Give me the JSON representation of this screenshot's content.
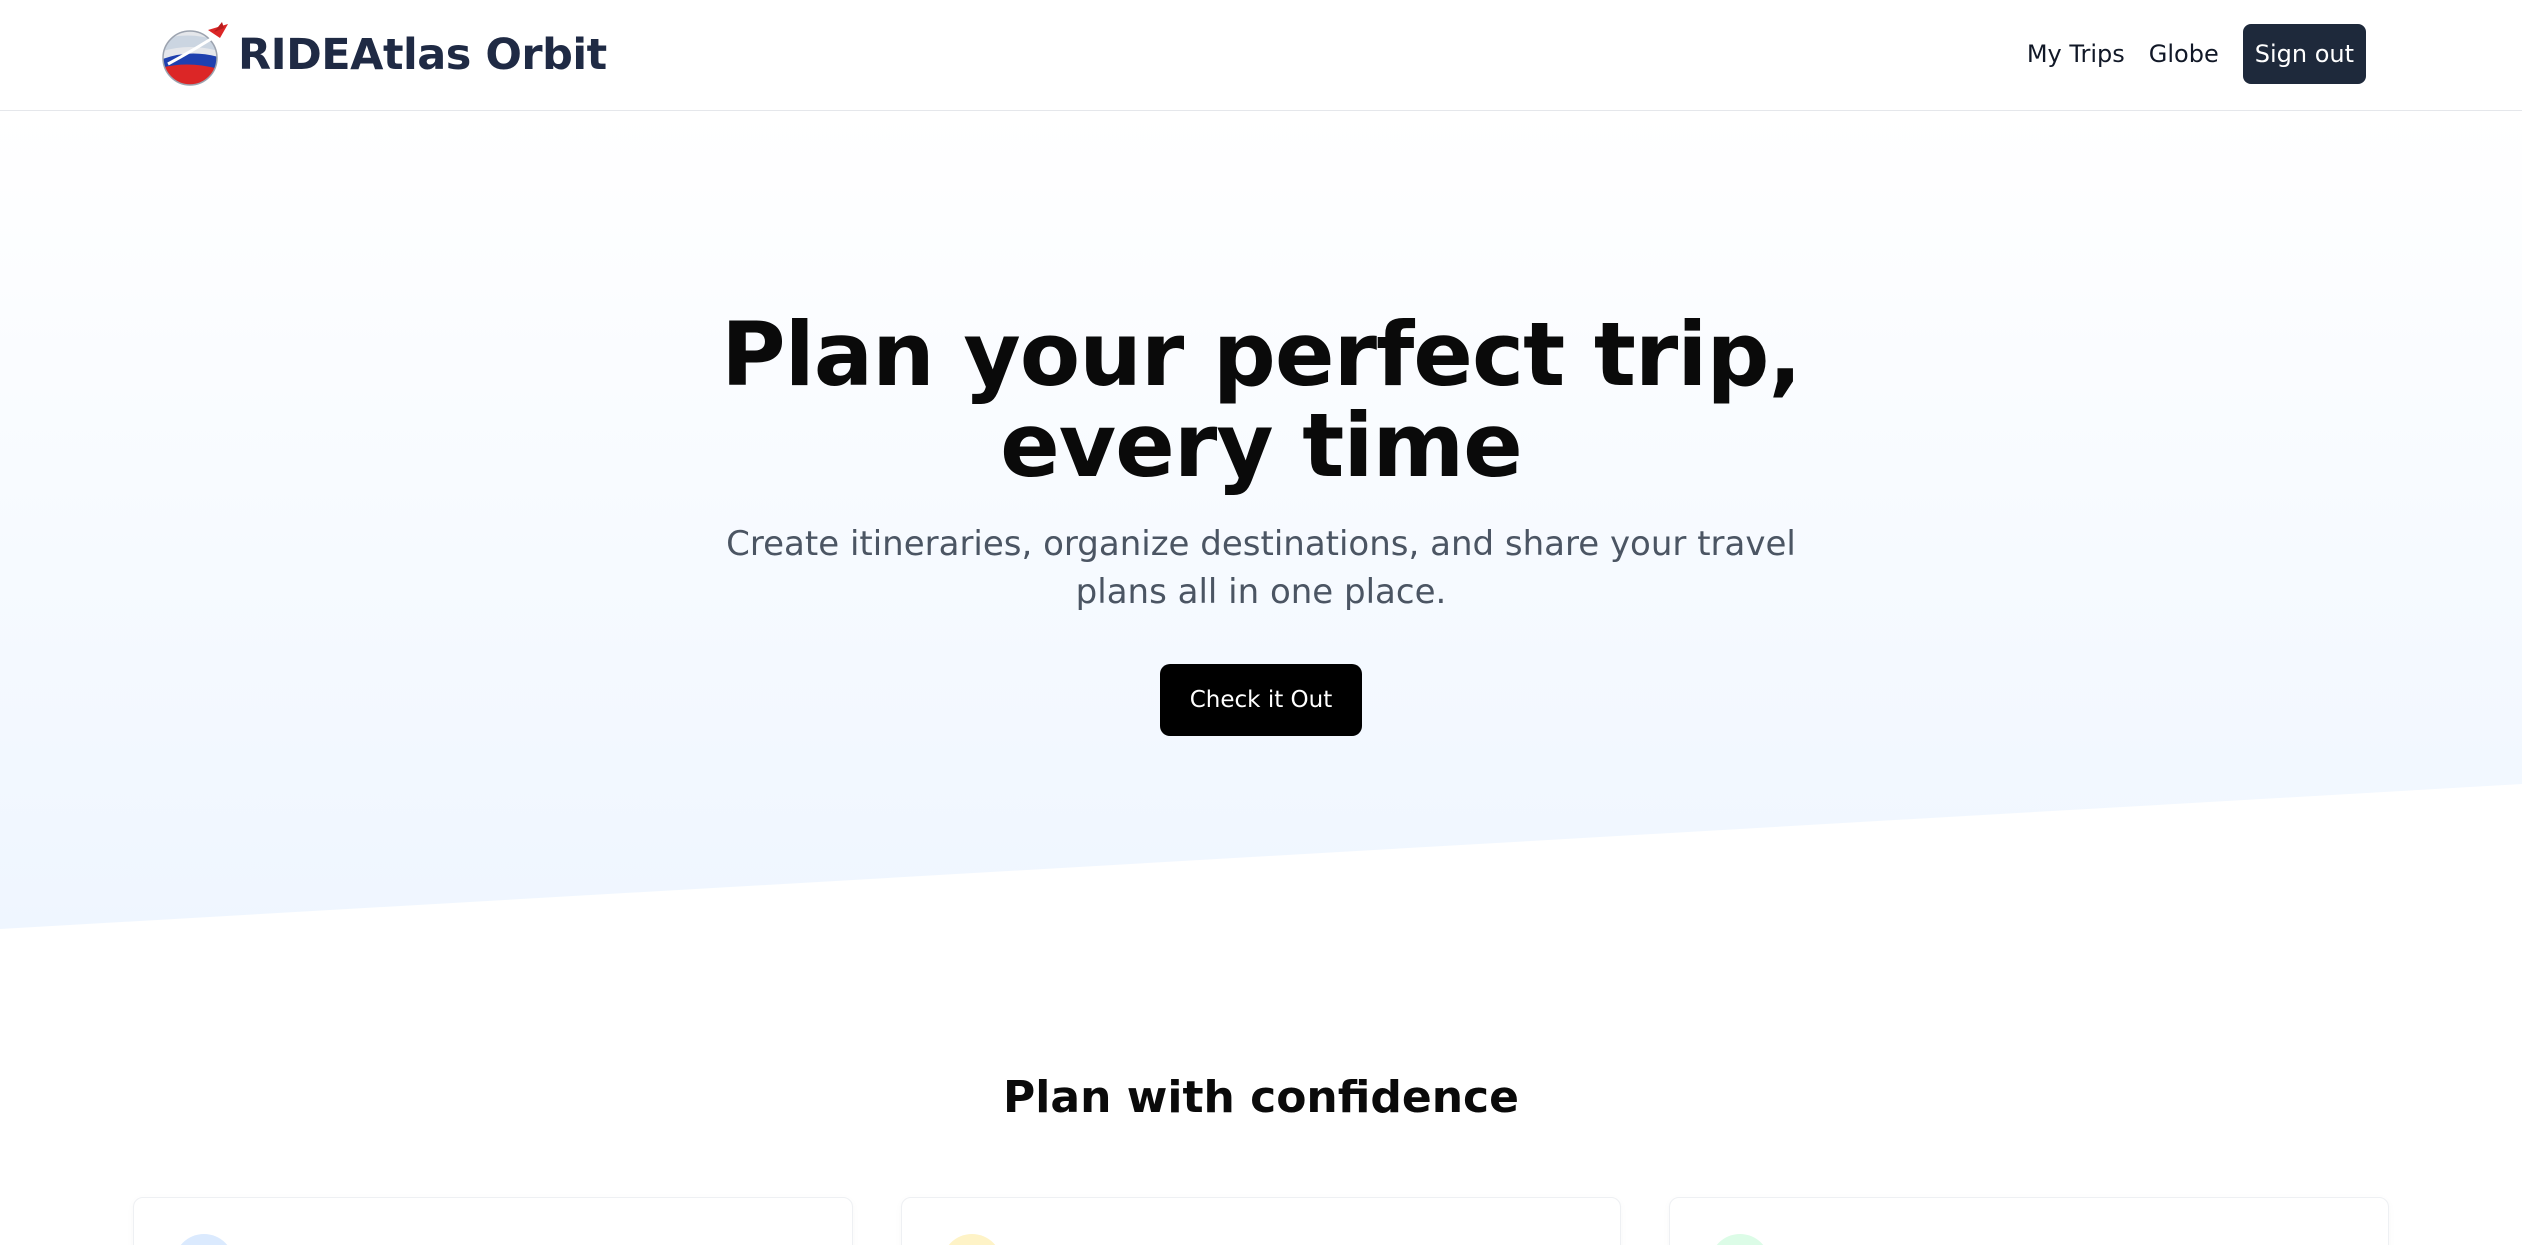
{
  "header": {
    "brand": "RIDEAtlas Orbit",
    "nav": {
      "my_trips": "My Trips",
      "globe": "Globe",
      "sign_out": "Sign out"
    }
  },
  "hero": {
    "title_line1": "Plan your perfect trip,",
    "title_line2": "every time",
    "subtitle": "Create itineraries, organize destinations, and share your travel plans all in one place.",
    "cta": "Check it Out"
  },
  "features": {
    "title": "Plan with confidence",
    "cards": [
      {
        "icon": "map-icon",
        "accent": "#dbeafe"
      },
      {
        "icon": "calendar-icon",
        "accent": "#fef3c7"
      },
      {
        "icon": "share-icon",
        "accent": "#dcfce7"
      }
    ]
  },
  "colors": {
    "brand_text": "#1f2a44",
    "sign_out_bg": "#1e293b",
    "cta_bg": "#000000",
    "hero_gradient_top": "#ffffff",
    "hero_gradient_bottom": "#eff6ff"
  }
}
